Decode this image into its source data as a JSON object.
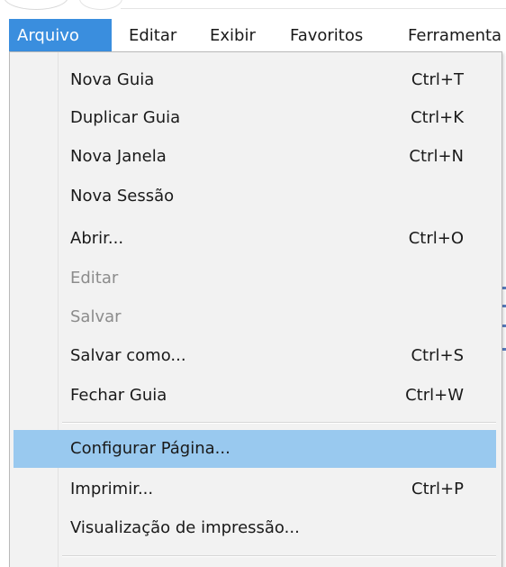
{
  "menubar": {
    "items": [
      {
        "label": "Arquivo"
      },
      {
        "label": "Editar"
      },
      {
        "label": "Exibir"
      },
      {
        "label": "Favoritos"
      },
      {
        "label": "Ferramenta"
      }
    ]
  },
  "menu": {
    "items": [
      {
        "label": "Nova Guia",
        "shortcut": "Ctrl+T",
        "enabled": true
      },
      {
        "label": "Duplicar Guia",
        "shortcut": "Ctrl+K",
        "enabled": true
      },
      {
        "label": "Nova Janela",
        "shortcut": "Ctrl+N",
        "enabled": true
      },
      {
        "label": "Nova Sessão",
        "shortcut": "",
        "enabled": true
      },
      {
        "label": "Abrir...",
        "shortcut": "Ctrl+O",
        "enabled": true
      },
      {
        "label": "Editar",
        "shortcut": "",
        "enabled": false
      },
      {
        "label": "Salvar",
        "shortcut": "",
        "enabled": false
      },
      {
        "label": "Salvar como...",
        "shortcut": "Ctrl+S",
        "enabled": true
      },
      {
        "label": "Fechar Guia",
        "shortcut": "Ctrl+W",
        "enabled": true
      },
      {
        "label": "Configurar Página...",
        "shortcut": "",
        "enabled": true,
        "highlighted": true
      },
      {
        "label": "Imprimir...",
        "shortcut": "Ctrl+P",
        "enabled": true
      },
      {
        "label": "Visualização de impressão...",
        "shortcut": "",
        "enabled": true
      }
    ]
  },
  "colors": {
    "active_menubar": "#3a8ede",
    "highlight_item": "#99c9ef",
    "menu_background": "#f2f2f2",
    "disabled_text": "#8c8c8c"
  }
}
